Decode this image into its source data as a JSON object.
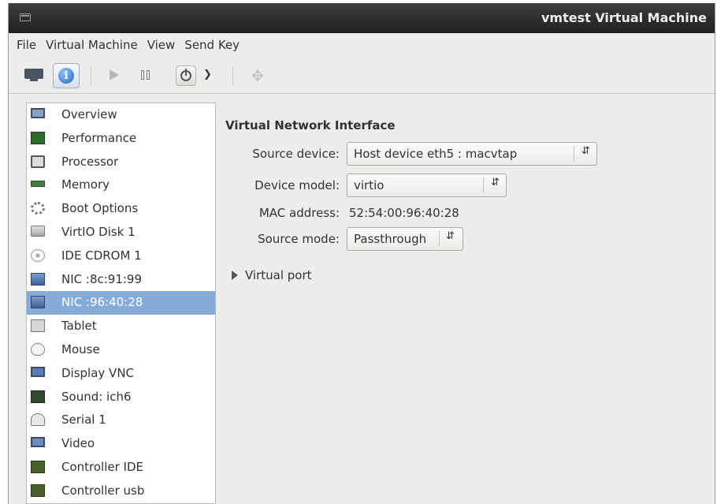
{
  "window": {
    "title": "vmtest Virtual Machine"
  },
  "menubar": {
    "items": [
      "File",
      "Virtual Machine",
      "View",
      "Send Key"
    ]
  },
  "sidebar": {
    "items": [
      {
        "label": "Overview",
        "icon": "monitor-icon"
      },
      {
        "label": "Performance",
        "icon": "performance-chart-icon"
      },
      {
        "label": "Processor",
        "icon": "processor-icon"
      },
      {
        "label": "Memory",
        "icon": "memory-icon"
      },
      {
        "label": "Boot Options",
        "icon": "boot-options-icon"
      },
      {
        "label": "VirtIO Disk 1",
        "icon": "disk-icon"
      },
      {
        "label": "IDE CDROM 1",
        "icon": "cdrom-icon"
      },
      {
        "label": "NIC :8c:91:99",
        "icon": "nic-icon"
      },
      {
        "label": "NIC :96:40:28",
        "icon": "nic-icon",
        "selected": true
      },
      {
        "label": "Tablet",
        "icon": "tablet-icon"
      },
      {
        "label": "Mouse",
        "icon": "mouse-icon"
      },
      {
        "label": "Display VNC",
        "icon": "display-icon"
      },
      {
        "label": "Sound: ich6",
        "icon": "sound-icon"
      },
      {
        "label": "Serial 1",
        "icon": "serial-icon"
      },
      {
        "label": "Video",
        "icon": "video-icon"
      },
      {
        "label": "Controller IDE",
        "icon": "controller-icon"
      },
      {
        "label": "Controller usb",
        "icon": "controller-icon"
      }
    ]
  },
  "main": {
    "section_title": "Virtual Network Interface",
    "source_device_label": "Source device:",
    "source_device_value": "Host device eth5 : macvtap",
    "device_model_label": "Device model:",
    "device_model_value": "virtio",
    "mac_label": "MAC address:",
    "mac_value": "52:54:00:96:40:28",
    "source_mode_label": "Source mode:",
    "source_mode_value": "Passthrough",
    "virtual_port_label": "Virtual port"
  },
  "colors": {
    "selection": "#86abd9",
    "titlebar": "#2a2a2a",
    "window_bg": "#ededeb"
  }
}
